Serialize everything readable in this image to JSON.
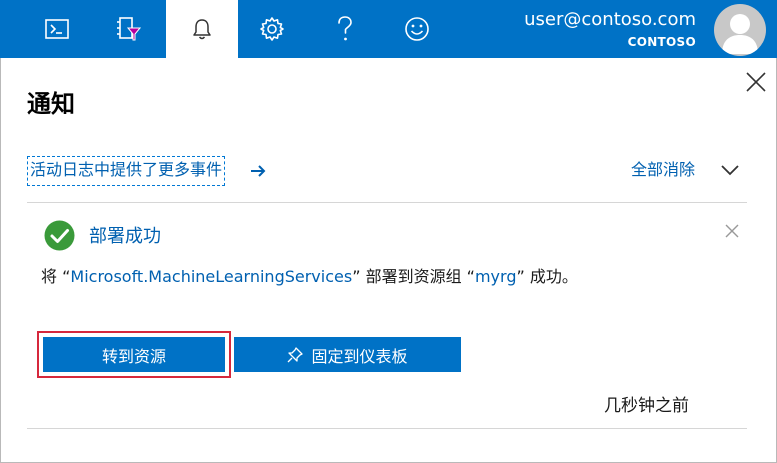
{
  "header": {
    "toolbar": [
      {
        "id": "cloud-shell",
        "icon": "cloud-shell-icon"
      },
      {
        "id": "directory-filter",
        "icon": "directory-filter-icon"
      },
      {
        "id": "notifications",
        "icon": "bell-icon",
        "active": true
      },
      {
        "id": "settings",
        "icon": "gear-icon"
      },
      {
        "id": "help",
        "icon": "help-icon"
      },
      {
        "id": "feedback",
        "icon": "smiley-icon"
      }
    ],
    "user": {
      "email": "user@contoso.com",
      "tenant": "CONTOSO"
    },
    "colors": {
      "bar": "#0072c6",
      "active_tab": "#ffffff"
    }
  },
  "panel": {
    "title": "通知",
    "activity_log_link": "活动日志中提供了更多事件",
    "dismiss_all": "全部消除",
    "notification": {
      "status": "success",
      "status_color": "#3a9a3a",
      "title": "部署成功",
      "body": {
        "prefix": "将 “",
        "resource": "Microsoft.MachineLearningServices",
        "middle": "” 部署到资源组 “",
        "group": "myrg",
        "suffix": "” 成功。"
      },
      "primary_button": "转到资源",
      "secondary_button": "固定到仪表板",
      "time": "几秒钟之前"
    },
    "colors": {
      "link": "#0060b0",
      "button": "#0072c6",
      "highlight_outline": "#d6283c"
    }
  }
}
